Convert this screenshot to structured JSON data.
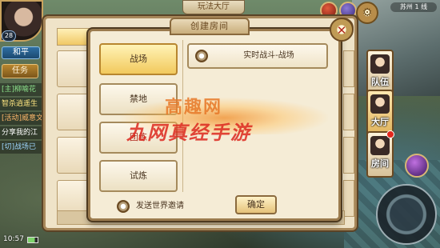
{
  "hud": {
    "level": "28",
    "peace_mode": "和平",
    "task_tab": "任务",
    "clock": "10:57",
    "chat": [
      "[主]柳喻花",
      "智杀逍遥生",
      "[活动]威意文",
      "分享我的江",
      "[切]战场已"
    ],
    "hall_title": "玩法大厅",
    "region": "苏州 1 线",
    "side_buttons": {
      "team": "队伍",
      "hall": "大厅",
      "room": "房间"
    }
  },
  "dialog": {
    "title": "创建房间",
    "modes": [
      "战场",
      "禁地",
      "团练",
      "试炼"
    ],
    "active_mode": "战场",
    "room_type": "实时战斗-战场",
    "invite_label": "发送世界邀请",
    "confirm_label": "确定"
  },
  "watermark": {
    "line1": "高趣网",
    "line2": "九网真经手游"
  },
  "colors": {
    "panel_bg": "#f5ecd6",
    "panel_border": "#9b7b4e",
    "active_button": "#f2c95d",
    "text_brown": "#4a3520",
    "accent_red": "#b0271c"
  }
}
